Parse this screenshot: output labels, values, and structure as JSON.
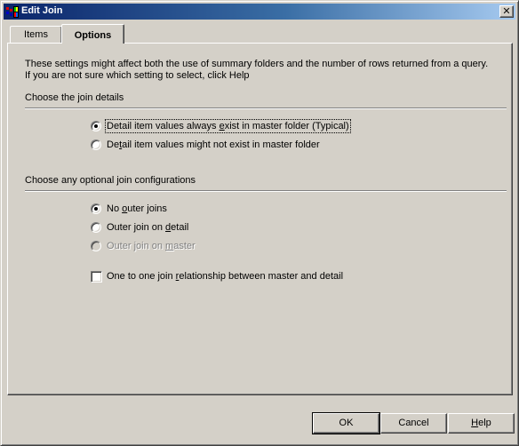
{
  "window": {
    "title": "Edit Join",
    "close_label": "✕"
  },
  "tabs": [
    {
      "label": "Items",
      "active": false
    },
    {
      "label": "Options",
      "active": true
    }
  ],
  "options_tab": {
    "intro_line1": "These settings might affect both the use of summary folders and the number of rows returned from a query.",
    "intro_line2": "If you are not sure which setting to select, click Help",
    "join_details_heading": "Choose the join details",
    "join_details": [
      {
        "pre": "Detail item values always ",
        "mnemonic": "e",
        "post": "xist in master folder (Typical)",
        "checked": true,
        "enabled": true,
        "focused": true
      },
      {
        "pre": "De",
        "mnemonic": "t",
        "post": "ail item values might not exist in master folder",
        "checked": false,
        "enabled": true,
        "focused": false
      }
    ],
    "optional_heading": "Choose any optional join configurations",
    "optional_configs": [
      {
        "pre": "No ",
        "mnemonic": "o",
        "post": "uter joins",
        "checked": true,
        "enabled": true
      },
      {
        "pre": "Outer join on ",
        "mnemonic": "d",
        "post": "etail",
        "checked": false,
        "enabled": true
      },
      {
        "pre": "Outer join on ",
        "mnemonic": "m",
        "post": "aster",
        "checked": false,
        "enabled": false
      }
    ],
    "one_to_one": {
      "pre": "One to one join ",
      "mnemonic": "r",
      "post": "elationship between master and detail",
      "checked": false
    }
  },
  "buttons": {
    "ok": "OK",
    "cancel": "Cancel",
    "help_mnemonic": "H",
    "help_rest": "elp"
  }
}
